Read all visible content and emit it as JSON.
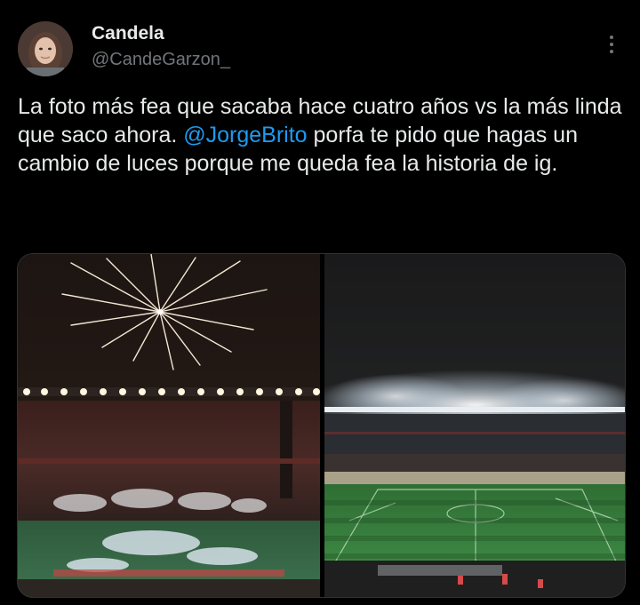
{
  "author": {
    "name": "Candela",
    "handle": "@CandeGarzon_"
  },
  "tweet": {
    "text_part1": "La foto más fea que sacaba hace cuatro años vs la más linda que saco ahora. ",
    "mention": "@JorgeBrito",
    "text_part2": " porfa te pido que hagas un cambio de luces porque me queda fea la historia de ig."
  },
  "icons": {
    "more": "more-options-icon"
  },
  "colors": {
    "background": "#000000",
    "text": "#e7e9ea",
    "secondary": "#71767b",
    "link": "#1d9bf0"
  }
}
